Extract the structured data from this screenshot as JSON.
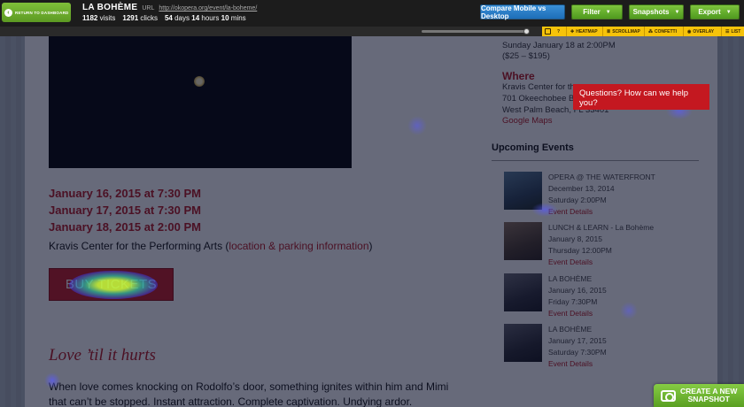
{
  "topbar": {
    "back_label": "RETURN TO DASHBOARD",
    "page_title": "LA BOHÈME",
    "url_prefix": "URL",
    "url": "http://okopera.org/event/la-boheme/",
    "visits_count": "1182",
    "visits_label": "visits",
    "clicks_count": "1291",
    "clicks_label": "clicks",
    "duration": {
      "days_value": "54",
      "days_label": "days",
      "hours_value": "14",
      "hours_label": "hours",
      "mins_value": "10",
      "mins_label": "mins"
    },
    "compare_label": "Compare Mobile vs Desktop",
    "filter_label": "Filter",
    "snapshots_label": "Snapshots",
    "export_label": "Export"
  },
  "toolbar": {
    "heatmap": "HEATMAP",
    "scrollmap": "SCROLLMAP",
    "confetti": "CONFETTI",
    "overlay": "OVERLAY",
    "list": "LIST"
  },
  "site": {
    "dates": [
      "January 16, 2015 at 7:30 PM",
      "January 17, 2015 at 7:30 PM",
      "January 18, 2015 at 2:00 PM"
    ],
    "venue_text": "Kravis Center for the Performing Arts (",
    "venue_link": "location & parking information",
    "venue_close": ")",
    "buy_label": "BUY TICKETS",
    "section_heading": "Love ’til it hurts",
    "body_text": "When love comes knocking on Rodolfo’s door, something ignites within him and Mimi that can’t be stopped. Instant attraction. Complete captivation. Undying ardor.",
    "sidebar": {
      "date_line": "Sunday January 18 at 2:00PM",
      "price_line": "($25 – $195)",
      "where_heading": "Where",
      "addr_1": "Kravis Center for the",
      "addr_2": "701 Okeechobee Blvd",
      "addr_3": "West Palm Beach, FL 33401",
      "maps_link": "Google Maps",
      "upcoming_heading": "Upcoming Events",
      "events": [
        {
          "title": "OPERA @ THE WATERFRONT",
          "date": "December 13, 2014",
          "time": "Saturday 2:00PM",
          "link": "Event Details"
        },
        {
          "title": "LUNCH & LEARN - La Bohème",
          "date": "January 8, 2015",
          "time": "Thursday 12:00PM",
          "link": "Event Details"
        },
        {
          "title": "LA BOHÈME",
          "date": "January 16, 2015",
          "time": "Friday 7:30PM",
          "link": "Event Details"
        },
        {
          "title": "LA BOHÈME",
          "date": "January 17, 2015",
          "time": "Saturday 7:30PM",
          "link": "Event Details"
        }
      ]
    },
    "chat_text": "Questions? How can we help you?"
  },
  "snapshot_button": {
    "line1": "CREATE A NEW",
    "line2": "SNAPSHOT"
  },
  "colors": {
    "accent_red": "#b5161f",
    "toolbar_yellow": "#f6c30a",
    "green": "#5c9a22",
    "blue": "#1d6eb8"
  }
}
